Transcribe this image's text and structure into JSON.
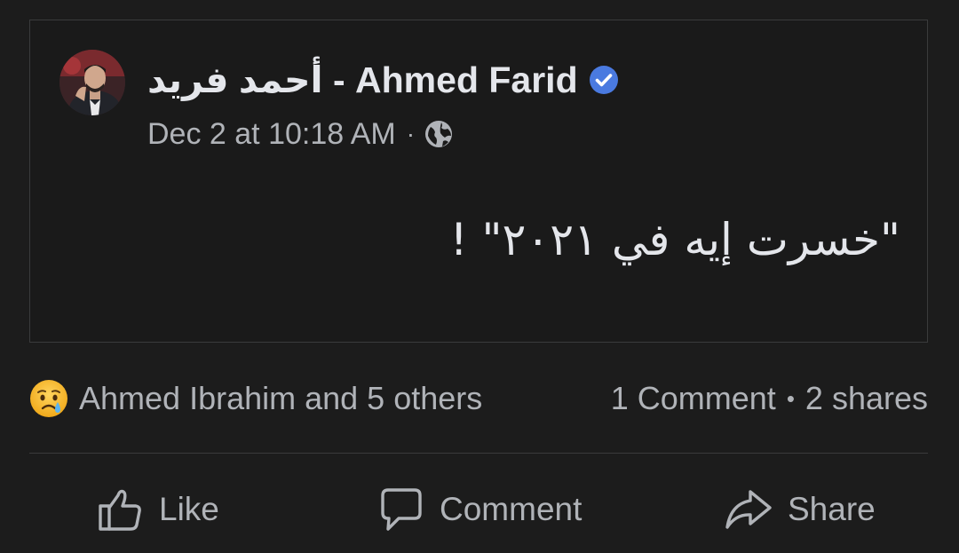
{
  "post": {
    "author_name": "أحمد فريد - Ahmed Farid",
    "verified_icon": "verified-badge-icon",
    "timestamp": "Dec 2 at 10:18 AM",
    "separator": "·",
    "privacy_icon": "globe-icon",
    "body_text": "\"خسرت إيه في ٢٠٢١\" !"
  },
  "reactions": {
    "emoji_icon": "sad-tear-emoji-icon",
    "names": "Ahmed Ibrahim and 5 others",
    "comments": "1 Comment",
    "separator": "•",
    "shares": "2 shares"
  },
  "actions": {
    "like_label": "Like",
    "comment_label": "Comment",
    "share_label": "Share"
  },
  "colors": {
    "background": "#1c1c1c",
    "text_primary": "#e4e6eb",
    "text_secondary": "#b0b3b8",
    "verified_blue": "#4a7ae0",
    "divider": "#3a3b3c"
  }
}
